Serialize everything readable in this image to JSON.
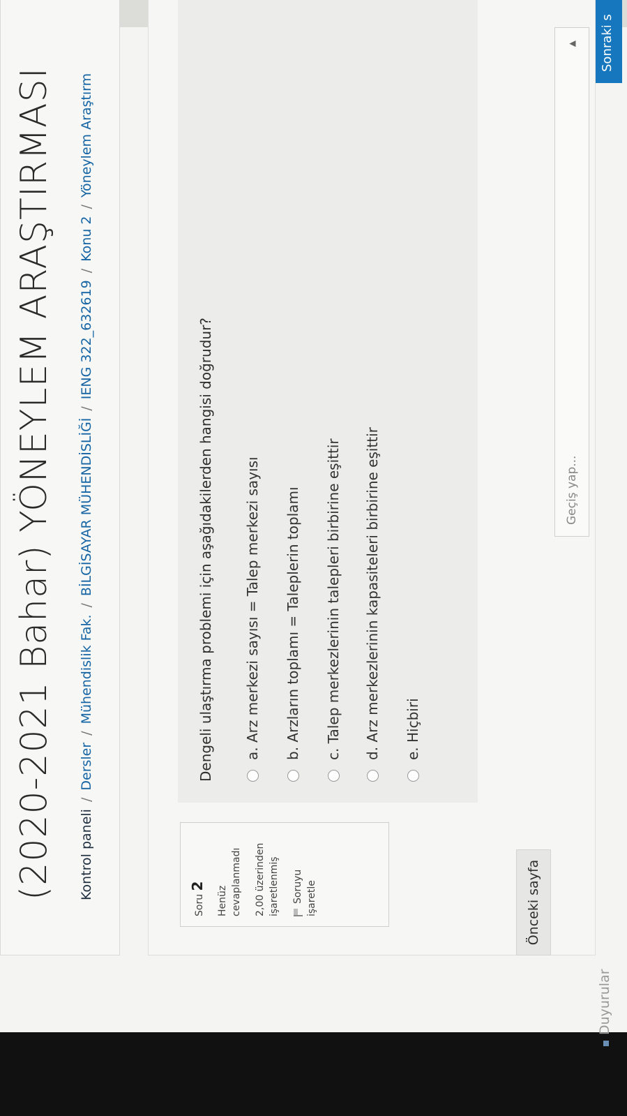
{
  "page": {
    "title": "(2020-2021 Bahar) YÖNEYLEM ARAŞTIRMASI"
  },
  "breadcrumb": [
    "Kontrol paneli",
    "Dersler",
    "Mühendislik Fak.",
    "BİLGİSAYAR MÜHENDİSLİĞİ",
    "IENG 322_632619",
    "Konu 2",
    "Yöneylem Araştırm"
  ],
  "nav": {
    "next_label": "Sonraki s",
    "prev_label": "Önceki sayfa",
    "jump_placeholder": "Geçiş yap...",
    "announcements_label": "Duyurular"
  },
  "question_info": {
    "label": "Soru",
    "number": "2",
    "status": "Henüz cevaplanmadı",
    "marks": "2,00 üzerinden işaretlenmiş",
    "flag_label": "Soruyu işaretle"
  },
  "question": {
    "text": "Dengeli ulaştırma problemi için aşağıdakilerden hangisi doğrudur?",
    "options": [
      "a. Arz merkezi sayısı = Talep merkezi sayısı",
      "b. Arzların toplamı = Taleplerin toplamı",
      "c. Talep merkezlerinin talepleri birbirine eşittir",
      "d. Arz merkezlerinin kapasiteleri birbirine eşittir",
      "e. Hiçbiri"
    ]
  },
  "colors": {
    "link": "#1565a5",
    "next_button_bg": "#1677be"
  }
}
